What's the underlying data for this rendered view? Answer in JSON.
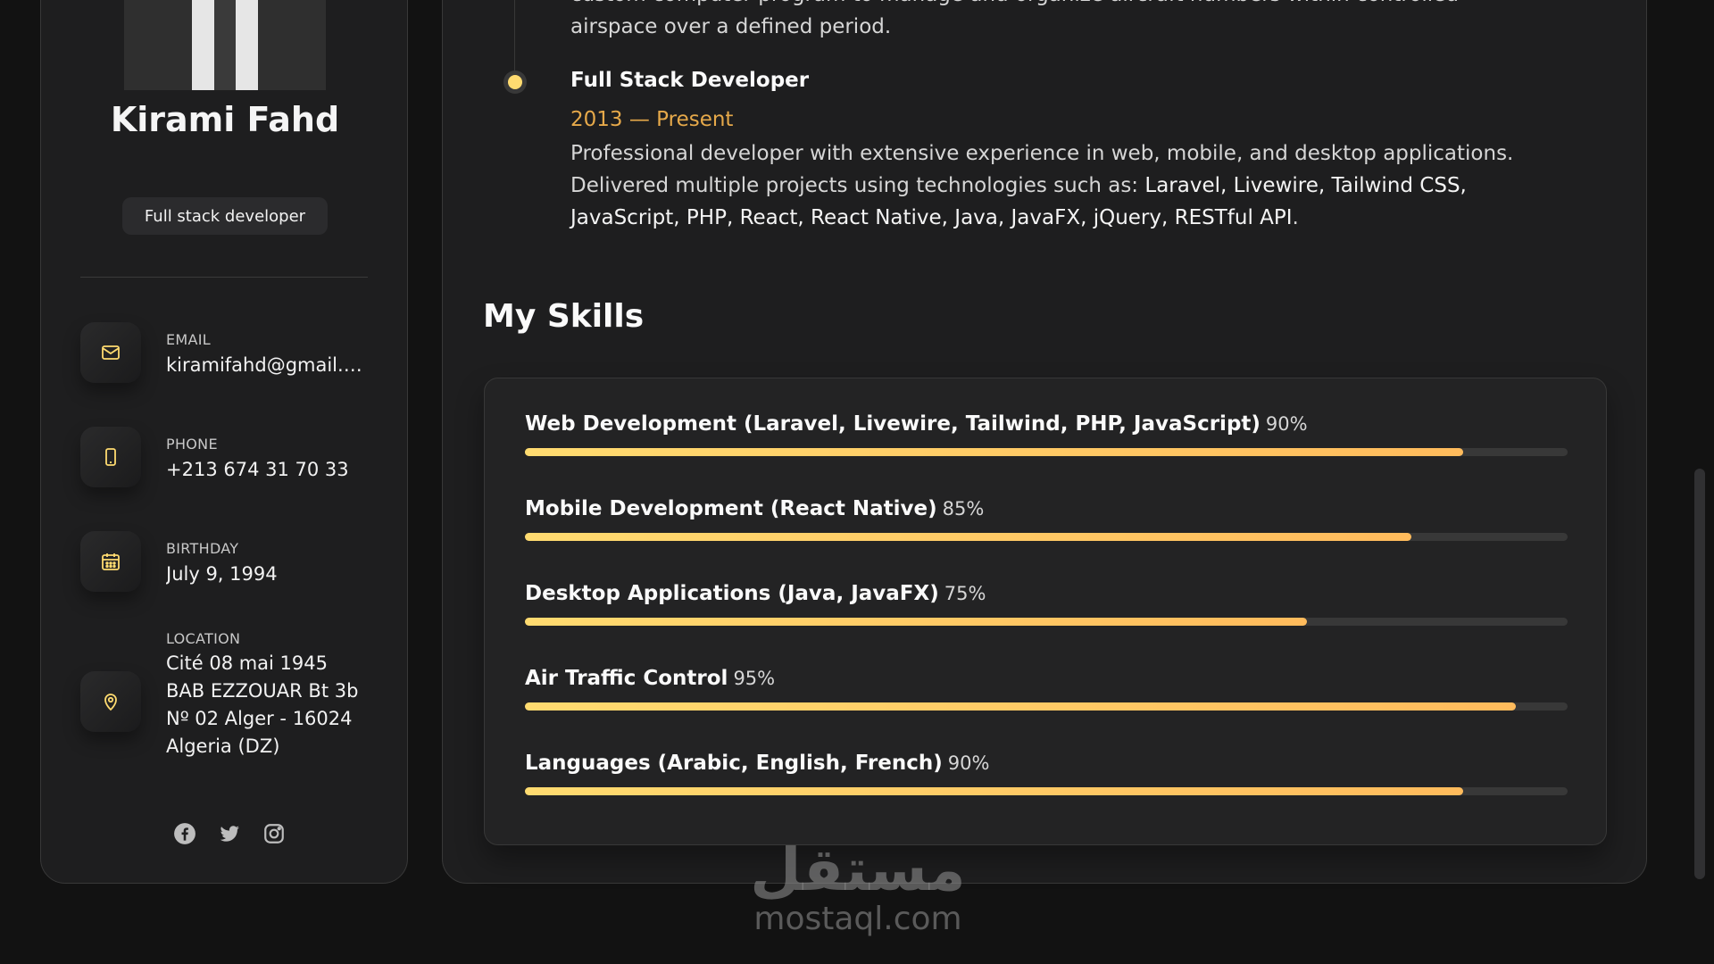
{
  "sidebar": {
    "name": "Kirami Fahd",
    "role": "Full stack developer",
    "contacts": [
      {
        "label": "EMAIL",
        "value": "kiramifahd@gmail.c...",
        "icon": "mail-icon"
      },
      {
        "label": "PHONE",
        "value": "+213 674 31 70 33",
        "icon": "phone-icon"
      },
      {
        "label": "BIRTHDAY",
        "value": "July 9, 1994",
        "icon": "calendar-icon"
      },
      {
        "label": "LOCATION",
        "value": "Cité 08 mai 1945 BAB EZZOUAR Bt 3b Nº 02 Alger - 16024 Algeria (DZ)",
        "icon": "location-pin-icon"
      }
    ],
    "socials": [
      "facebook-icon",
      "twitter-icon",
      "instagram-icon"
    ]
  },
  "timeline": {
    "prev_desc_tail": "custom computer program to manage and organize aircraft numbers within controlled airspace over a defined period.",
    "item": {
      "title": "Full Stack Developer",
      "date": "2013 — Present",
      "desc_intro": "Professional developer with extensive experience in web, mobile, and desktop applications. Delivered multiple projects using technologies such as: ",
      "desc_tech": "Laravel, Livewire, Tailwind CSS, JavaScript, PHP, React, React Native, Java, JavaFX, jQuery, RESTful API",
      "desc_end": "."
    }
  },
  "skills": {
    "title": "My Skills",
    "items": [
      {
        "name": "Web Development (Laravel, Livewire, Tailwind, PHP, JavaScript)",
        "percent_label": "90%",
        "value": 90
      },
      {
        "name": "Mobile Development (React Native)",
        "percent_label": "85%",
        "value": 85
      },
      {
        "name": "Desktop Applications (Java, JavaFX)",
        "percent_label": "75%",
        "value": 75
      },
      {
        "name": "Air Traffic Control",
        "percent_label": "95%",
        "value": 95
      },
      {
        "name": "Languages (Arabic, English, French)",
        "percent_label": "90%",
        "value": 90
      }
    ]
  },
  "colors": {
    "accent": "#ffdb70",
    "accent_end": "#ffbb5c",
    "date": "#e6a94a",
    "background": "#121212",
    "card": "#1e1e1f"
  },
  "watermark": {
    "logo": "مستقل",
    "text": "mostaql.com"
  }
}
